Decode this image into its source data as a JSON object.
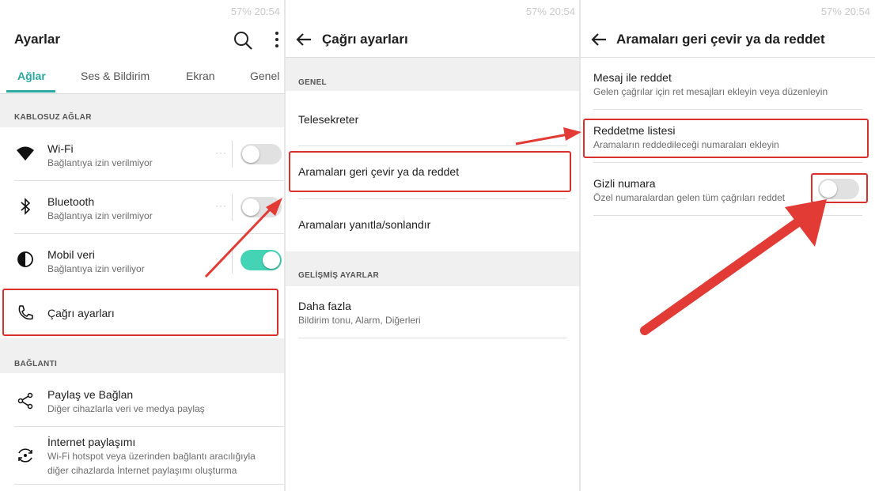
{
  "status_bar": {
    "text": "57%  20:54"
  },
  "panel1": {
    "title": "Ayarlar",
    "tabs": [
      "Ağlar",
      "Ses & Bildirim",
      "Ekran",
      "Genel"
    ],
    "sections": {
      "wireless": "KABLOSUZ AĞLAR",
      "connection": "BAĞLANTI"
    },
    "items": [
      {
        "title": "Wi-Fi",
        "subtitle": "Bağlantıya izin verilmiyor",
        "toggle": "off"
      },
      {
        "title": "Bluetooth",
        "subtitle": "Bağlantıya izin verilmiyor",
        "toggle": "off"
      },
      {
        "title": "Mobil veri",
        "subtitle": "Bağlantıya izin veriliyor",
        "toggle": "on"
      },
      {
        "title": "Çağrı ayarları"
      },
      {
        "title": "Paylaş ve Bağlan",
        "subtitle": "Diğer cihazlarla veri ve medya paylaş"
      },
      {
        "title": "İnternet paylaşımı",
        "subtitle1": "Wi-Fi hotspot veya üzerinden bağlantı aracılığıyla",
        "subtitle2": "diğer cihazlarda İnternet paylaşımı oluşturma"
      }
    ]
  },
  "panel2": {
    "title": "Çağrı ayarları",
    "sections": {
      "general": "GENEL",
      "advanced": "GELİŞMİŞ AYARLAR"
    },
    "items": [
      {
        "title": "Telesekreter"
      },
      {
        "title": "Aramaları geri çevir ya da reddet"
      },
      {
        "title": "Aramaları yanıtla/sonlandır"
      },
      {
        "title": "Daha fazla",
        "subtitle": "Bildirim tonu, Alarm, Diğerleri"
      }
    ]
  },
  "panel3": {
    "title": "Aramaları geri çevir ya da reddet",
    "items": [
      {
        "title": "Mesaj ile reddet",
        "subtitle": "Gelen çağrılar için ret mesajları ekleyin veya düzenleyin"
      },
      {
        "title": "Reddetme listesi",
        "subtitle": "Aramaların reddedileceği numaraları ekleyin"
      },
      {
        "title": "Gizli numara",
        "subtitle": "Özel numaralardan gelen tüm çağrıları reddet",
        "toggle": "off"
      }
    ]
  },
  "colors": {
    "accent": "#2aa8a1",
    "toggle_on": "#45d3b6",
    "highlight": "#d9302e"
  }
}
